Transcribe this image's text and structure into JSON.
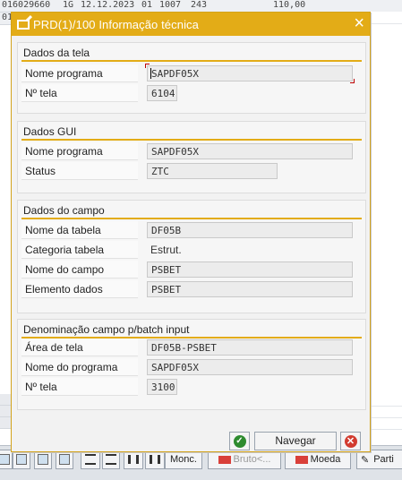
{
  "background": {
    "row_text": {
      "c1": "016029660",
      "c2": "1G",
      "c3": "12.12.2023",
      "c4": "01",
      "c5": "1007",
      "c6": "243",
      "c7": "110,00"
    },
    "row2_prefix": "01"
  },
  "dialog": {
    "title": "PRD(1)/100 Informação técnica",
    "close_glyph": "×",
    "groups": [
      {
        "title": "Dados da tela",
        "rows": [
          {
            "label": "Nome programa",
            "value": "SAPDF05X"
          },
          {
            "label": "Nº tela",
            "value": "6104"
          }
        ]
      },
      {
        "title": "Dados GUI",
        "rows": [
          {
            "label": "Nome programa",
            "value": "SAPDF05X"
          },
          {
            "label": "Status",
            "value": "ZTC"
          }
        ]
      },
      {
        "title": "Dados do campo",
        "rows": [
          {
            "label": "Nome da tabela",
            "value": "DF05B"
          },
          {
            "label": "Categoria tabela",
            "value": "Estrut."
          },
          {
            "label": "Nome do campo",
            "value": "PSBET"
          },
          {
            "label": "Elemento dados",
            "value": "PSBET"
          }
        ]
      },
      {
        "title": "Denominação campo p/batch input",
        "rows": [
          {
            "label": "Área de tela",
            "value": "DF05B-PSBET"
          },
          {
            "label": "Nome do programa",
            "value": "SAPDF05X"
          },
          {
            "label": "Nº tela",
            "value": "3100"
          }
        ]
      }
    ],
    "buttons": {
      "ok_icon": "check-icon",
      "navigate_label": "Navegar",
      "cancel_icon": "cancel-icon"
    }
  },
  "bottom_toolbar": {
    "currency_label": "Monc.",
    "bruto_label": "Bruto<...",
    "moeda_label": "Moeda",
    "parti_label": "Parti"
  },
  "colors": {
    "dialog_accent": "#e3ac17",
    "ok_green": "#2e8b2e",
    "cancel_red": "#d23b2f"
  }
}
